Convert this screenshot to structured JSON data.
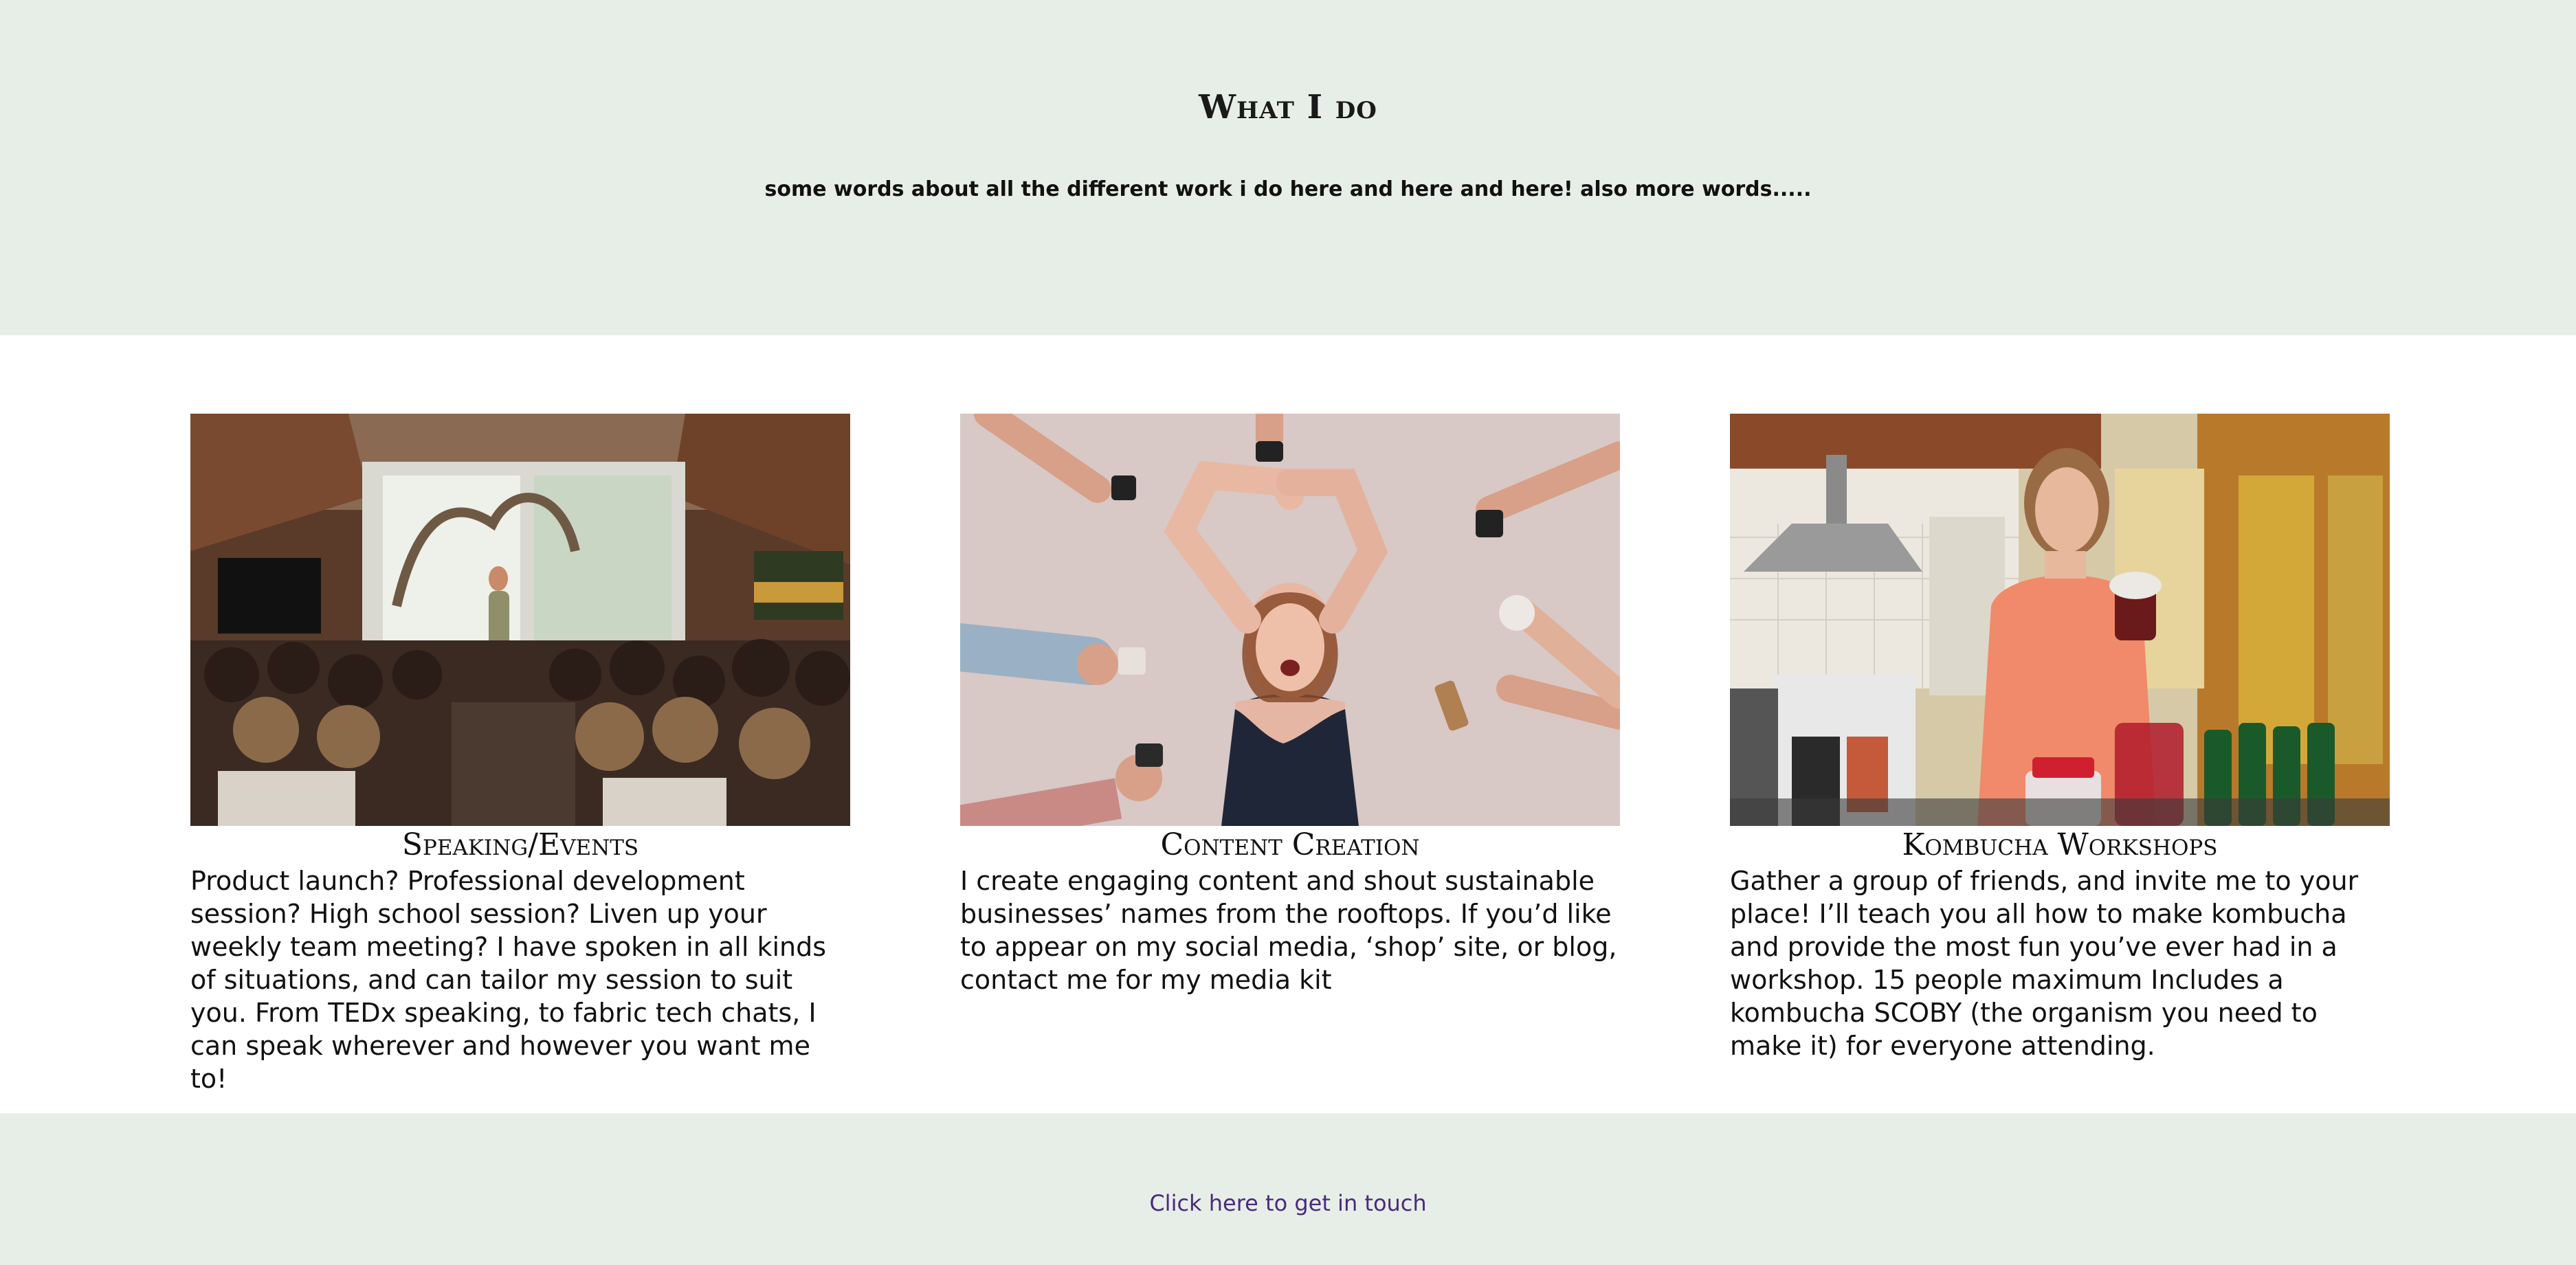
{
  "hero": {
    "title": "What I do",
    "subtitle": "some words about all the different work i do here and here and here! also more words....."
  },
  "services": [
    {
      "title": "Speaking/Events",
      "text": "Product launch? Professional development session? High school session? Liven up your weekly team meeting? I have spoken in all kinds of situations, and can tailor my session to suit you. From TEDx speaking, to fabric tech chats, I can speak wherever and however you want me to!"
    },
    {
      "title": "Content Creation",
      "text": "I create engaging content and shout sustainable businesses’ names from the rooftops. If you’d like to appear on my social media, ‘shop’ site, or blog, contact me for my media kit"
    },
    {
      "title": "Kombucha Workshops",
      "text": "Gather a group of friends, and invite me to your place! I’ll teach you all how to make kombucha and provide the most fun you’ve ever had in a workshop. 15 people maximum Includes a kombucha SCOBY (the organism you need to make it) for everyone attending."
    }
  ],
  "footer": {
    "contact_label": "Click here to get in touch"
  },
  "colors": {
    "band": "#e7eee7",
    "link": "#4b2a7d",
    "text": "#111111"
  }
}
